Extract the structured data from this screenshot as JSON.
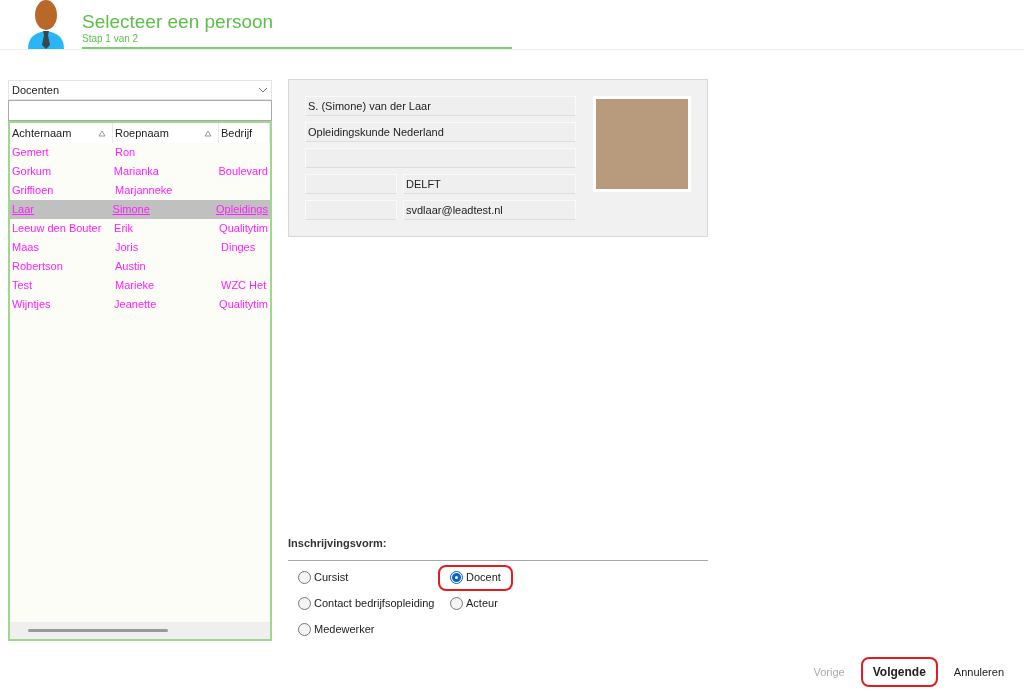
{
  "header": {
    "title": "Selecteer een persoon",
    "subtitle": "Stap 1 van 2"
  },
  "list_panel": {
    "dropdown": {
      "value": "Docenten"
    },
    "columns": [
      {
        "label": "Achternaam",
        "sortable": true
      },
      {
        "label": "Roepnaam",
        "sortable": true
      },
      {
        "label": "Bedrijf",
        "sortable": false
      }
    ],
    "rows": [
      {
        "cells": [
          "Gemert",
          "Ron",
          ""
        ],
        "selected": false
      },
      {
        "cells": [
          "Gorkum",
          "Marianka",
          "Boulevard"
        ],
        "selected": false
      },
      {
        "cells": [
          "Griffioen",
          "Marjanneke",
          ""
        ],
        "selected": false
      },
      {
        "cells": [
          "Laar",
          "Simone",
          "Opleidings"
        ],
        "selected": true
      },
      {
        "cells": [
          "Leeuw den Bouter",
          "Erik",
          "Qualitytim"
        ],
        "selected": false
      },
      {
        "cells": [
          "Maas",
          "Joris",
          "Dinges"
        ],
        "selected": false
      },
      {
        "cells": [
          "Robertson",
          "Austin",
          ""
        ],
        "selected": false
      },
      {
        "cells": [
          "Test",
          "Marieke",
          "WZC Het"
        ],
        "selected": false
      },
      {
        "cells": [
          "Wijntjes",
          "Jeanette",
          "Qualitytim"
        ],
        "selected": false
      }
    ]
  },
  "details": {
    "name": "S. (Simone) van der Laar",
    "company": "Opleidingskunde Nederland",
    "city": "DELFT",
    "email": "svdlaar@leadtest.nl"
  },
  "enrollment": {
    "label": "Inschrijvingsvorm:",
    "options": [
      {
        "label": "Cursist",
        "selected": false,
        "highlighted": false
      },
      {
        "label": "Docent",
        "selected": true,
        "highlighted": true
      },
      {
        "label": "Contact bedrijfsopleiding",
        "selected": false,
        "highlighted": false
      },
      {
        "label": "Acteur",
        "selected": false,
        "highlighted": false
      },
      {
        "label": "Medewerker",
        "selected": false,
        "highlighted": false
      }
    ]
  },
  "buttons": [
    {
      "label": "Vorige",
      "disabled": true,
      "highlighted": false
    },
    {
      "label": "Volgende",
      "disabled": false,
      "highlighted": true
    },
    {
      "label": "Annuleren",
      "disabled": false,
      "highlighted": false
    }
  ]
}
